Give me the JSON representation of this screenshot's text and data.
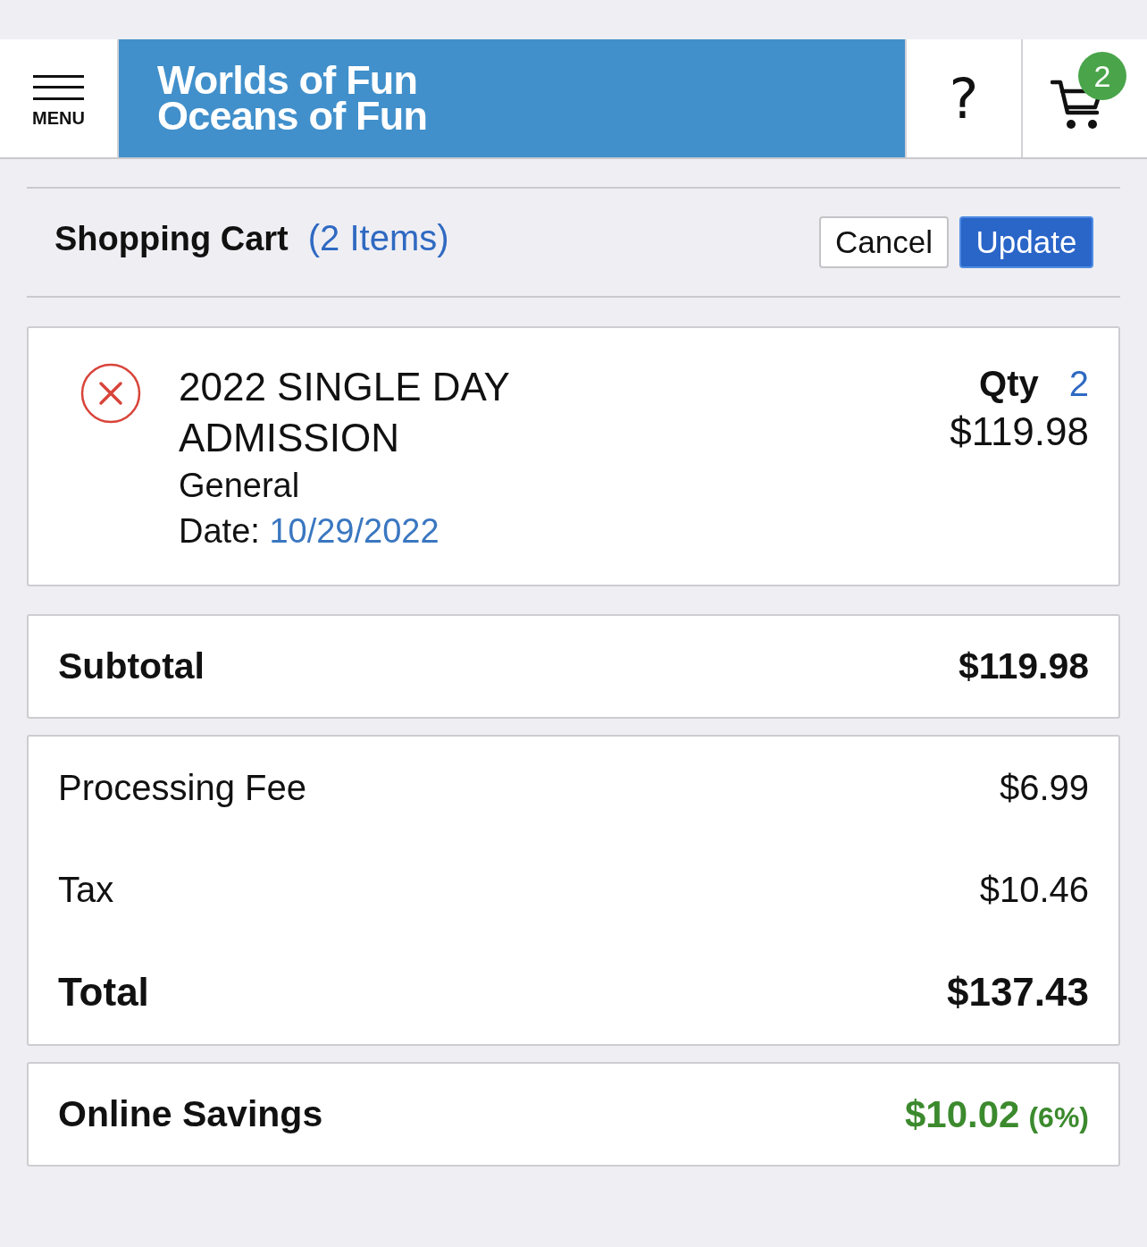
{
  "header": {
    "menu_label": "MENU",
    "logo_lines": [
      "Worlds of Fun",
      "Oceans of Fun"
    ],
    "help_label": "?",
    "cart_count": "2"
  },
  "cart": {
    "title": "Shopping Cart",
    "item_count": "(2 Items)",
    "buttons": [
      {
        "label": "Cancel",
        "kind": "cancel"
      },
      {
        "label": "Update",
        "kind": "update"
      }
    ]
  },
  "items": [
    {
      "name": "2022 SINGLE DAY ADMISSION",
      "variant": "General",
      "date_label": "Date:",
      "date": "10/29/2022",
      "qty_label": "Qty",
      "qty": "2",
      "price": "$119.98"
    }
  ],
  "summary": [
    {
      "rows": [
        {
          "kind": "subtotal",
          "label": "Subtotal",
          "value": "$119.98"
        }
      ]
    },
    {
      "rows": [
        {
          "kind": "fee",
          "label": "Processing Fee",
          "value": "$6.99"
        },
        {
          "kind": "fee",
          "label": "Tax",
          "value": "$10.46"
        },
        {
          "kind": "total",
          "label": "Total",
          "value": "$137.43"
        }
      ]
    },
    {
      "rows": [
        {
          "kind": "savings",
          "label": "Online Savings",
          "value": "$10.02",
          "note": "(6%)"
        }
      ]
    }
  ]
}
